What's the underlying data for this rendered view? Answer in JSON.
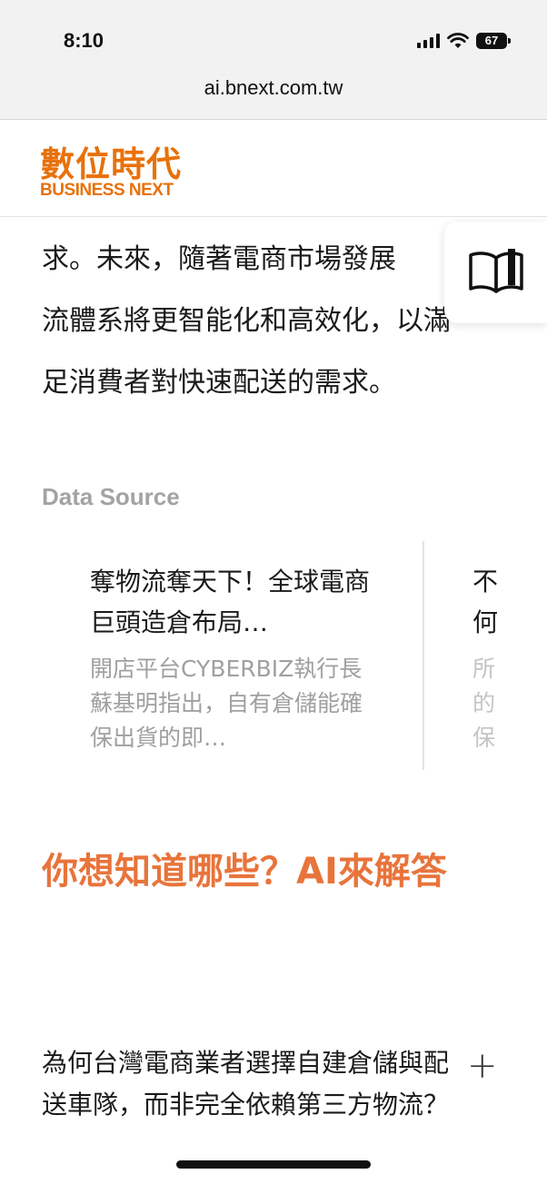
{
  "status_bar": {
    "time": "8:10",
    "battery": "67"
  },
  "address_bar": {
    "url": "ai.bnext.com.tw"
  },
  "logo": {
    "chinese": "數位時代",
    "english": "BUSINESS NEXT"
  },
  "article": {
    "lines": [
      "求。未來，隨著電商市場發展",
      "流體系將更智能化和高效化，以滿",
      "足消費者對快速配送的需求。"
    ]
  },
  "data_source": {
    "title": "Data Source",
    "cards": [
      {
        "title": "奪物流奪天下！全球電商巨頭造倉布局…",
        "description": "開店平台CYBERBIZ執行長蘇基明指出，自有倉儲能確保出貨的即…"
      },
      {
        "title": "不何",
        "description": "所的保"
      }
    ]
  },
  "faq": {
    "heading": "你想知道哪些？AI來解答",
    "items": [
      {
        "question": "為何台灣電商業者選擇自建倉儲與配送車隊，而非完全依賴第三方物流？",
        "toggle": "+"
      }
    ]
  },
  "icons": {
    "reader": "book-icon",
    "expand": "plus-icon"
  }
}
